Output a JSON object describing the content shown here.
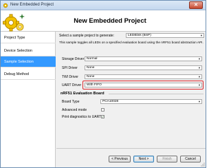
{
  "window": {
    "title": "New Embedded Project",
    "close_glyph": "✕"
  },
  "header": {
    "title": "New Embedded Project"
  },
  "sidebar": {
    "items": [
      {
        "label": "Project Type",
        "active": false
      },
      {
        "label": "Device Selection",
        "active": false
      },
      {
        "label": "Sample Selection",
        "active": true
      },
      {
        "label": "Debug Method",
        "active": false
      }
    ]
  },
  "sample": {
    "label": "Select a sample project to generate:",
    "value": "LEDBlink (BSP)",
    "description": "This sample toggles all LEDs on a specified evaluation board using the nRF51 board abstraction API."
  },
  "drivers": [
    {
      "label": "Storage Driver",
      "value": "Normal",
      "highlighted": false
    },
    {
      "label": "SPI Driver",
      "value": "None",
      "highlighted": false
    },
    {
      "label": "TWI Driver",
      "value": "None",
      "highlighted": false
    },
    {
      "label": "UART Driver",
      "value": "With FIFO",
      "highlighted": true
    }
  ],
  "board_section": {
    "title": "nRF51 Evaluation Board",
    "board_type_label": "Board Type",
    "board_type_value": "PCA10028",
    "advanced_label": "Advanced mode",
    "advanced_checked": false,
    "diag_label": "Print diagnostics to UART",
    "diag_checked": true
  },
  "buttons": {
    "previous": "< Previous",
    "next": "Next >",
    "finish": "Finish",
    "cancel": "Cancel"
  },
  "colors": {
    "active_item": "#3399ff",
    "highlight_border": "#d9262b",
    "gear_body": "#f2c200",
    "gear_shadow": "#b88a00",
    "sparkle": "#3a7f3a"
  },
  "icons": {
    "select_arrow": "▼",
    "check": "✓"
  }
}
